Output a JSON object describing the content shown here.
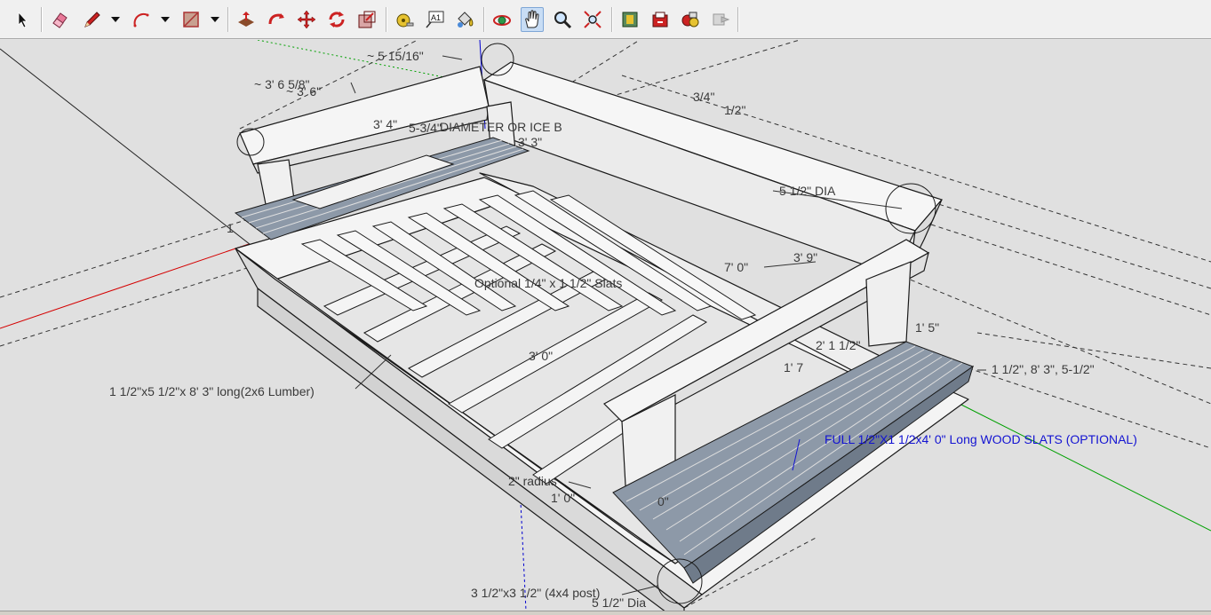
{
  "toolbar": {
    "tools": [
      {
        "name": "select-tool",
        "icon": "arrow-cursor-icon"
      },
      {
        "name": "eraser-tool",
        "icon": "eraser-icon"
      },
      {
        "name": "line-tool",
        "icon": "pencil-icon"
      },
      {
        "name": "arc-tool",
        "icon": "arc-icon"
      },
      {
        "name": "rectangle-tool",
        "icon": "rectangle-icon"
      },
      {
        "name": "push-pull-tool",
        "icon": "push-pull-icon"
      },
      {
        "name": "follow-me-tool",
        "icon": "follow-me-icon"
      },
      {
        "name": "move-tool",
        "icon": "move-arrows-icon"
      },
      {
        "name": "rotate-tool",
        "icon": "rotate-icon"
      },
      {
        "name": "scale-tool",
        "icon": "scale-icon"
      },
      {
        "name": "tape-measure-tool",
        "icon": "tape-measure-icon"
      },
      {
        "name": "text-tool",
        "icon": "text-label-icon"
      },
      {
        "name": "paint-bucket-tool",
        "icon": "paint-bucket-icon"
      },
      {
        "name": "orbit-tool",
        "icon": "orbit-icon"
      },
      {
        "name": "pan-tool",
        "icon": "hand-icon"
      },
      {
        "name": "zoom-tool",
        "icon": "magnifier-icon"
      },
      {
        "name": "zoom-extents-tool",
        "icon": "zoom-extents-icon"
      },
      {
        "name": "warehouse-tool",
        "icon": "warehouse-icon"
      },
      {
        "name": "share-model-tool",
        "icon": "share-model-icon"
      },
      {
        "name": "components-tool",
        "icon": "components-icon"
      },
      {
        "name": "extension-tool",
        "icon": "extension-icon"
      }
    ],
    "active_tool": "pan-tool"
  },
  "dimensions": {
    "d1": "~ 5 15/16\"",
    "d2": "~ 3' 6 5/8\"",
    "d3": "~ 3' 6\"",
    "d4": "3/4\"",
    "d5": "1/2\"",
    "d6": "5-3/4\"",
    "d7": "3' 4\"",
    "d8": "DIAMETER OR ICE B",
    "d9": "3' 3\"",
    "d10": "5 1/2\" DIA",
    "d11": "1",
    "d12": "7' 0\"",
    "d13": "3' 9\"",
    "d14": "Optional 1/4\" x 1 1/2\" Slats",
    "d15": "1' 5\"",
    "d16": "2' 1 1/2\"",
    "d17": "1' 7",
    "d18": "1 1/2\", 8' 3\", 5-1/2\"",
    "d19": "3' 0\"",
    "d20": "1 1/2\"x5 1/2\"x 8' 3\" long(2x6 Lumber)",
    "d21": "FULL 1/2\"X1 1/2x4' 0\" Long WOOD SLATS (OPTIONAL)",
    "d22": "2\" radius",
    "d23": "1' 0\"",
    "d24": "0\"",
    "d25": "3 1/2\"x3 1/2\" (4x4 post)",
    "d26": "5 1/2\" Dia"
  },
  "colors": {
    "background": "#e0e0e0",
    "wood_face": "#f4f4f4",
    "wood_side": "#dadada",
    "slat_blue": "#8d99a8",
    "slat_dark": "#6f7b8a",
    "edge": "#1a1a1a",
    "axis_red": "#d40000",
    "axis_green": "#00a000",
    "axis_blue": "#0000d0",
    "note_blue": "#1414d2"
  }
}
